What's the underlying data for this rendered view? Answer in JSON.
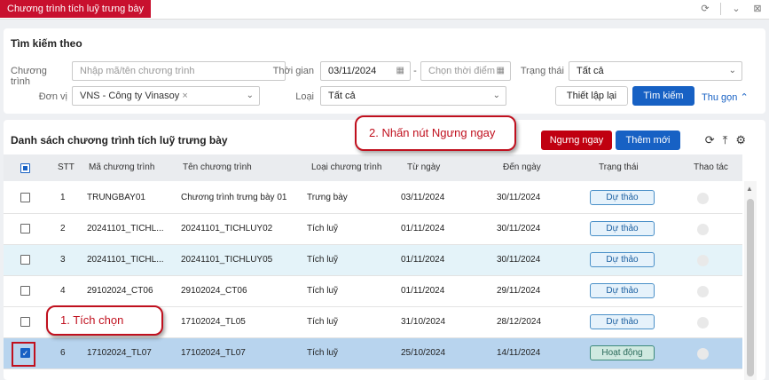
{
  "topbar": {
    "tab_title": "Chương trình tích luỹ trưng bày",
    "icons": [
      "refresh-icon",
      "chevron-down-icon",
      "close-icon"
    ]
  },
  "search": {
    "title": "Tìm kiếm theo",
    "program_label": "Chương trình",
    "program_placeholder": "Nhập mã/tên chương trình",
    "time_label": "Thời gian",
    "date_from": "03/11/2024",
    "date_sep": "-",
    "date_to_placeholder": "Chọn thời điểm",
    "status_label": "Trạng thái",
    "status_value": "Tất cả",
    "unit_label": "Đơn vị",
    "unit_value": "VNS - Công ty Vinasoy",
    "type_label": "Loại",
    "type_value": "Tất cả",
    "reset_label": "Thiết lập lại",
    "search_label": "Tìm kiếm",
    "collapse_label": "Thu gọn"
  },
  "list": {
    "title": "Danh sách chương trình tích luỹ trưng bày",
    "stop_label": "Ngưng ngay",
    "new_label": "Thêm mới",
    "columns": [
      "STT",
      "Mã chương trình",
      "Tên chương trình",
      "Loại chương trình",
      "Từ ngày",
      "Đến ngày",
      "Trạng thái",
      "Thao tác"
    ],
    "rows": [
      {
        "stt": "1",
        "code": "TRUNGBAY01",
        "name": "Chương trình trưng bày 01",
        "type": "Trưng bày",
        "from": "03/11/2024",
        "to": "30/11/2024",
        "status": "Dự thảo"
      },
      {
        "stt": "2",
        "code": "20241101_TICHL...",
        "name": "20241101_TICHLUY02",
        "type": "Tích luỹ",
        "from": "01/11/2024",
        "to": "30/11/2024",
        "status": "Dự thảo"
      },
      {
        "stt": "3",
        "code": "20241101_TICHL...",
        "name": "20241101_TICHLUY05",
        "type": "Tích luỹ",
        "from": "01/11/2024",
        "to": "30/11/2024",
        "status": "Dự thảo"
      },
      {
        "stt": "4",
        "code": "29102024_CT06",
        "name": "29102024_CT06",
        "type": "Tích luỹ",
        "from": "01/11/2024",
        "to": "29/11/2024",
        "status": "Dự thảo"
      },
      {
        "stt": "5",
        "code": "17102024_TL05",
        "name": "17102024_TL05",
        "type": "Tích luỹ",
        "from": "31/10/2024",
        "to": "28/12/2024",
        "status": "Dự thảo"
      },
      {
        "stt": "6",
        "code": "17102024_TL07",
        "name": "17102024_TL07",
        "type": "Tích luỹ",
        "from": "25/10/2024",
        "to": "14/11/2024",
        "status": "Hoạt động"
      }
    ]
  },
  "callouts": {
    "step1": "1. Tích chọn",
    "step2": "2. Nhấn nút Ngưng ngay"
  }
}
